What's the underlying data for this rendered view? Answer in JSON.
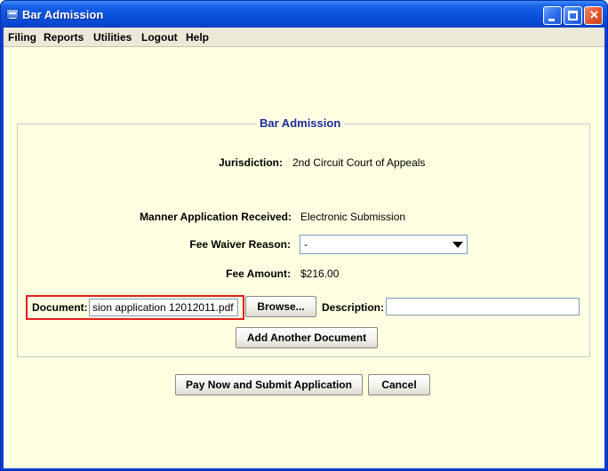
{
  "window": {
    "title": "Bar Admission"
  },
  "menu": {
    "items": [
      "Filing",
      "Reports",
      "Utilities",
      "Logout",
      "Help"
    ]
  },
  "form": {
    "group_title": "Bar Admission",
    "jurisdiction_label": "Jurisdiction:",
    "jurisdiction_value": "2nd Circuit Court of Appeals",
    "manner_label": "Manner Application Received:",
    "manner_value": "Electronic Submission",
    "fee_waiver_label": "Fee Waiver Reason:",
    "fee_waiver_value": "-",
    "fee_amount_label": "Fee Amount:",
    "fee_amount_value": "$216.00",
    "document_label": "Document:",
    "document_value": "sion application 12012011.pdf",
    "browse_label": "Browse...",
    "description_label": "Description:",
    "description_value": "",
    "add_document_label": "Add Another Document"
  },
  "actions": {
    "submit_label": "Pay Now and Submit Application",
    "cancel_label": "Cancel"
  },
  "colors": {
    "title_bar": "#0a54e0",
    "content_background": "#ffffe2",
    "group_title": "#1c2c9c",
    "highlight": "#e0201a"
  }
}
